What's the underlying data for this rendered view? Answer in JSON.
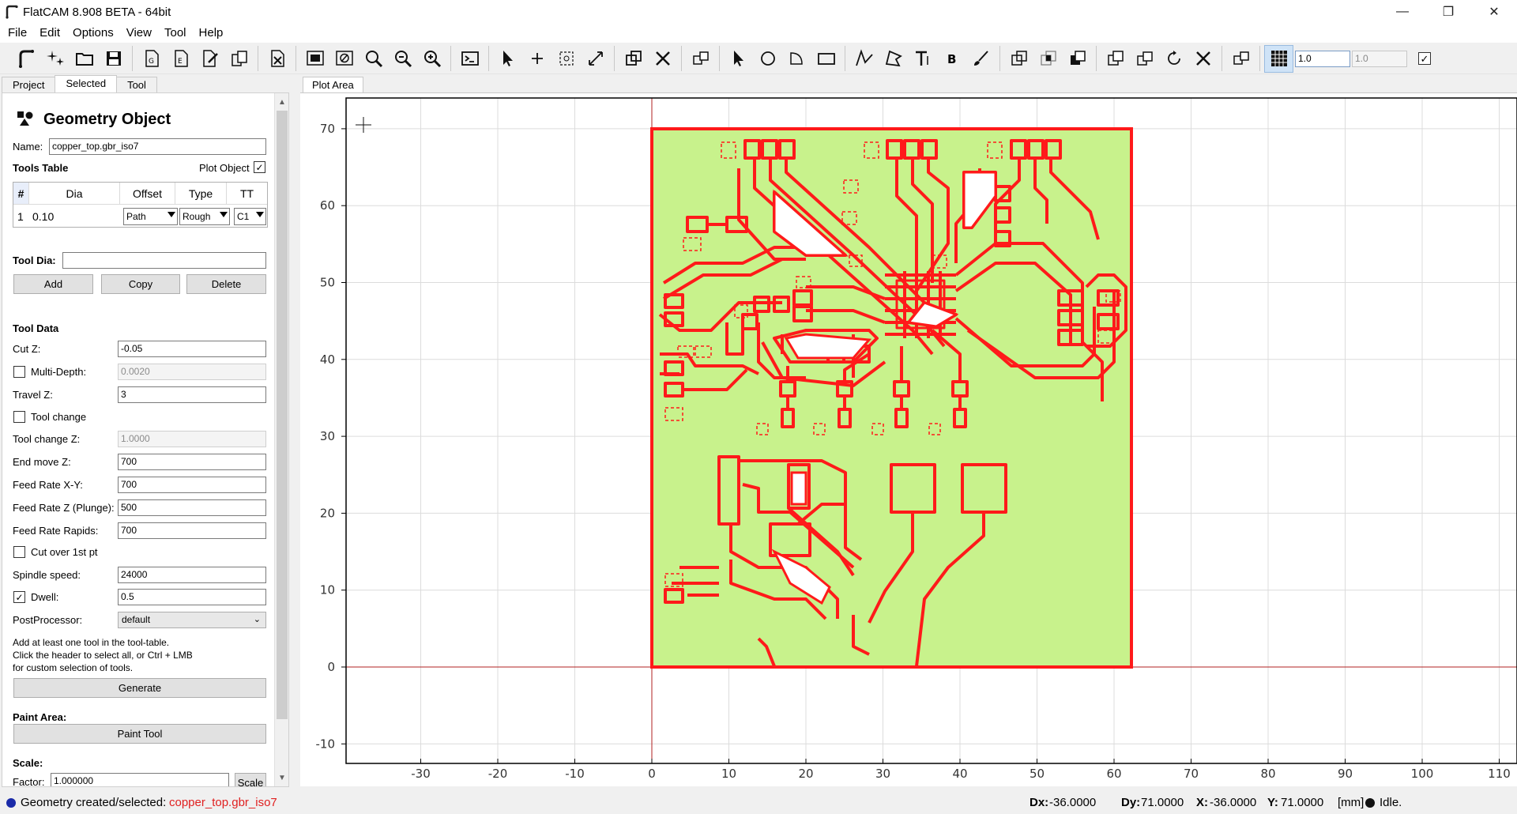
{
  "window": {
    "title": "FlatCAM 8.908 BETA - 64bit",
    "minimize": "—",
    "restore": "❐",
    "close": "✕"
  },
  "menu": [
    "File",
    "Edit",
    "Options",
    "View",
    "Tool",
    "Help"
  ],
  "toolbar": {
    "grid_x": "1.0",
    "grid_y": "1.0",
    "snap_checked": "✓"
  },
  "left_tabs": [
    "Project",
    "Selected",
    "Tool"
  ],
  "panel": {
    "header": "Geometry Object",
    "name_label": "Name:",
    "name_value": "copper_top.gbr_iso7",
    "tools_table_label": "Tools Table",
    "plot_object_label": "Plot Object",
    "plot_object_checked": "✓",
    "table": {
      "headers": [
        "#",
        "Dia",
        "Offset",
        "Type",
        "TT"
      ],
      "row": {
        "num": "1",
        "dia": "0.10",
        "offset": "Path",
        "type": "Rough",
        "tt": "C1"
      }
    },
    "tool_dia_label": "Tool Dia:",
    "tool_dia_value": "",
    "btn_add": "Add",
    "btn_copy": "Copy",
    "btn_delete": "Delete",
    "tool_data_label": "Tool Data",
    "cut_z_label": "Cut Z:",
    "cut_z": "-0.05",
    "multi_depth_label": "Multi-Depth:",
    "multi_depth": "0.0020",
    "travel_z_label": "Travel Z:",
    "travel_z": "3",
    "tool_change_label": "Tool change",
    "tool_change_z_label": "Tool change Z:",
    "tool_change_z": "1.0000",
    "end_move_z_label": "End move Z:",
    "end_move_z": "700",
    "feed_xy_label": "Feed Rate X-Y:",
    "feed_xy": "700",
    "feed_z_label": "Feed Rate Z (Plunge):",
    "feed_z": "500",
    "feed_rapids_label": "Feed Rate Rapids:",
    "feed_rapids": "700",
    "cut_over_label": "Cut over 1st pt",
    "spindle_label": "Spindle speed:",
    "spindle": "24000",
    "dwell_label": "Dwell:",
    "dwell_checked": "✓",
    "dwell": "0.5",
    "post_label": "PostProcessor:",
    "post": "default",
    "help_1": "Add at least one tool in the tool-table.",
    "help_2": "Click the header to select all, or Ctrl + LMB",
    "help_3": "for custom selection of tools.",
    "btn_generate": "Generate",
    "paint_area_label": "Paint Area:",
    "btn_paint": "Paint Tool",
    "scale_label": "Scale:",
    "factor_label": "Factor:",
    "factor": "1.000000",
    "btn_scale": "Scale"
  },
  "plot": {
    "tab": "Plot Area",
    "x_ticks": [
      "-30",
      "-20",
      "-10",
      "0",
      "10",
      "20",
      "30",
      "40",
      "50",
      "60",
      "70",
      "80",
      "90",
      "100",
      "110"
    ],
    "y_ticks": [
      "70",
      "60",
      "50",
      "40",
      "30",
      "20",
      "10",
      "0",
      "-10"
    ],
    "colors": {
      "board_fill": "#c8f28c",
      "isolation": "#ff0000",
      "grid": "#dcdcdc",
      "axis": "#b22222"
    }
  },
  "status": {
    "message": "Geometry created/selected: ",
    "object": "copper_top.gbr_iso7",
    "dx_label": "Dx:",
    "dx": "-36.0000",
    "dy_label": "Dy:",
    "dy": "71.0000",
    "x_label": "X:",
    "x": "-36.0000",
    "y_label": "Y:",
    "y": "71.0000",
    "units": "[mm]",
    "state": "Idle."
  }
}
